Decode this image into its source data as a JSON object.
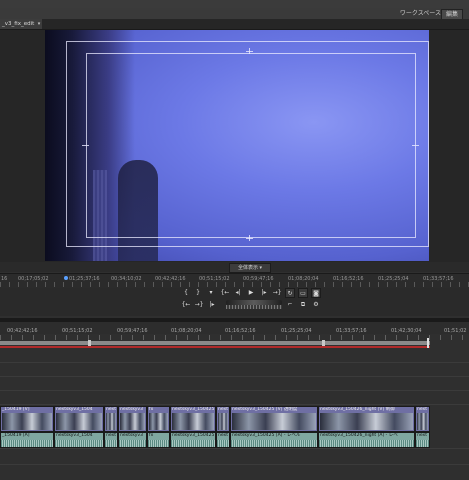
{
  "menu": {
    "workspace_label": "ワークスペース",
    "edit_button": "編集"
  },
  "sequence_tab": {
    "label": "_v3_fix_edit",
    "menu_icon": "dropdown-arrow"
  },
  "monitor": {
    "zoom_select": "全体表示"
  },
  "monitor_ruler": {
    "labels": [
      "16",
      "00;17;05;02",
      "01;25;37;16",
      "00;34;10;02",
      "00;42;42;16",
      "00;51;15;02",
      "00;59;47;16",
      "01;08;20;04",
      "01;16;52;16",
      "01;25;25;04",
      "01;33;57;16"
    ]
  },
  "transport": {
    "row1": [
      "mark-in",
      "mark-out",
      "add-marker",
      "go-to-in",
      "step-back",
      "play",
      "step-forward",
      "go-to-out",
      "loop",
      "safe-margins",
      "export-frame"
    ],
    "row2": [
      "insert",
      "overwrite",
      "lift-extract"
    ]
  },
  "timeline_ruler": {
    "labels": [
      "00;42;42;16",
      "00;51;15;02",
      "00;59;47;16",
      "01;08;20;04",
      "01;16;52;16",
      "01;25;25;04",
      "01;33;57;16",
      "01;42;30;04",
      "01;51;02"
    ]
  },
  "video_clips": [
    {
      "name": "_150419 [V]"
    },
    {
      "name": "nextskyv3_1504"
    },
    {
      "name": "next"
    },
    {
      "name": "nextskyv3"
    },
    {
      "name": "fx"
    },
    {
      "name": "nextskyv3_150425"
    },
    {
      "name": "next"
    },
    {
      "name": "nextskyv3_150425 [V] 透明度"
    },
    {
      "name": "nextskyv3_150426_night [V] 制御"
    },
    {
      "name": "next"
    }
  ],
  "audio_clips": [
    {
      "name": "_150419 [A]"
    },
    {
      "name": "nextskyv3_1504"
    },
    {
      "name": "next"
    },
    {
      "name": "nextskyv3"
    },
    {
      "name": "fx"
    },
    {
      "name": "nextskyv3_150425"
    },
    {
      "name": "next"
    },
    {
      "name": "nextskyv3_150425 [A] - レベル"
    },
    {
      "name": "nextskyv3_150426_night [A] - レベ"
    },
    {
      "name": "next"
    }
  ],
  "colors": {
    "video_clip": "#6f6fa4",
    "audio_clip": "#7fa7a0",
    "playhead_line": "#b02a2a",
    "accent": "#5aa0ff"
  }
}
